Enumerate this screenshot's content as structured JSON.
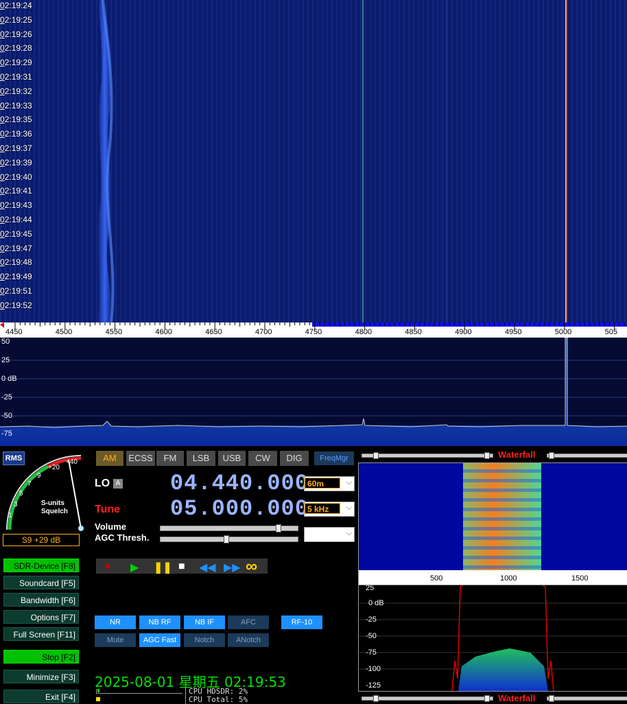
{
  "waterfall": {
    "timestamps": [
      "02:19:24",
      "02:19:25",
      "02:19:26",
      "02:19:28",
      "02:19:29",
      "02:19:31",
      "02:19:32",
      "02:19:33",
      "02:19:35",
      "02:19:36",
      "02:19:37",
      "02:19:39",
      "02:19:40",
      "02:19:41",
      "02:19:43",
      "02:19:44",
      "02:19:45",
      "02:19:47",
      "02:19:48",
      "02:19:49",
      "02:19:51",
      "02:19:52"
    ]
  },
  "freq_scale": [
    "4450",
    "4500",
    "4550",
    "4600",
    "4650",
    "4700",
    "4750",
    "4800",
    "4850",
    "4900",
    "4950",
    "5000",
    "505"
  ],
  "spectrum_db": [
    "50",
    "25",
    "0 dB",
    "-25",
    "-50",
    "-75"
  ],
  "meter": {
    "rms_label": "RMS",
    "scale": [
      "1",
      "3",
      "5",
      "7",
      "9",
      "+20",
      "+40"
    ],
    "title1": "S-units",
    "title2": "Squelch",
    "reading": "S9 +29 dB"
  },
  "modes": [
    {
      "label": "AM",
      "active": true
    },
    {
      "label": "ECSS",
      "active": false
    },
    {
      "label": "FM",
      "active": false
    },
    {
      "label": "LSB",
      "active": false
    },
    {
      "label": "USB",
      "active": false
    },
    {
      "label": "CW",
      "active": false
    },
    {
      "label": "DIG",
      "active": false
    }
  ],
  "freqmgr_label": "FreqMgr",
  "lo": {
    "label": "LO",
    "badge": "A",
    "value": "04.440.000",
    "band": "60m"
  },
  "tune": {
    "label": "Tune",
    "value": "05.000.000",
    "step": "5 kHz"
  },
  "volume_label": "Volume",
  "agc_label": "AGC Thresh.",
  "left_buttons": [
    {
      "label": "SDR-Device [F8]",
      "green": true
    },
    {
      "label": "Soundcard [F5]",
      "green": false
    },
    {
      "label": "Bandwidth [F6]",
      "green": false
    },
    {
      "label": "Options [F7]",
      "green": false
    },
    {
      "label": "Full Screen [F11]",
      "green": false
    },
    {
      "label": "Stop [F2]",
      "green": true
    },
    {
      "label": "Minimize [F3]",
      "green": false
    },
    {
      "label": "Exit [F4]",
      "green": false
    }
  ],
  "dsp_row1": [
    {
      "label": "NR",
      "on": true
    },
    {
      "label": "NB RF",
      "on": true
    },
    {
      "label": "NB IF",
      "on": true
    },
    {
      "label": "AFC",
      "on": false
    },
    {
      "label": "RF-10",
      "on": true
    }
  ],
  "dsp_row2": [
    {
      "label": "Mute",
      "on": false
    },
    {
      "label": "AGC Fast",
      "on": true
    },
    {
      "label": "Notch",
      "on": false
    },
    {
      "label": "ANotch",
      "on": false
    }
  ],
  "clock": "2025-08-01 星期五 02:19:53",
  "cpu": {
    "hdsdr": "CPU HDSDR: 2%",
    "total": "CPU Total: 5%"
  },
  "audio": {
    "title": "Waterfall",
    "title_bottom": "Waterfall",
    "freq_ticks": [
      "500",
      "1000",
      "1500"
    ],
    "db_ticks": [
      "25",
      "0 dB",
      "-25",
      "-50",
      "-75",
      "-100",
      "-125"
    ]
  },
  "colors": {
    "accent": "#ffb020",
    "tune_red": "#ff2020",
    "wf_blue": "#0a1a66"
  }
}
